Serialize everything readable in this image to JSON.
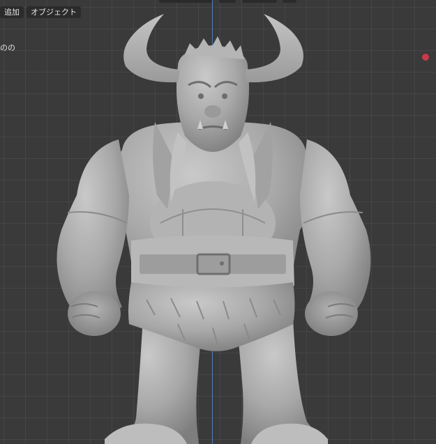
{
  "header": {
    "menu": [
      {
        "key": "add",
        "label": "追加"
      },
      {
        "key": "object",
        "label": "オブジェクト"
      }
    ]
  },
  "overlay": {
    "text": "のの"
  },
  "colors": {
    "background": "#3a3a3a",
    "axis_z": "#4d7fb8",
    "light_marker": "#c8394a",
    "clay": "#a6a6a6"
  },
  "icons": {
    "light": "light-marker-icon"
  }
}
